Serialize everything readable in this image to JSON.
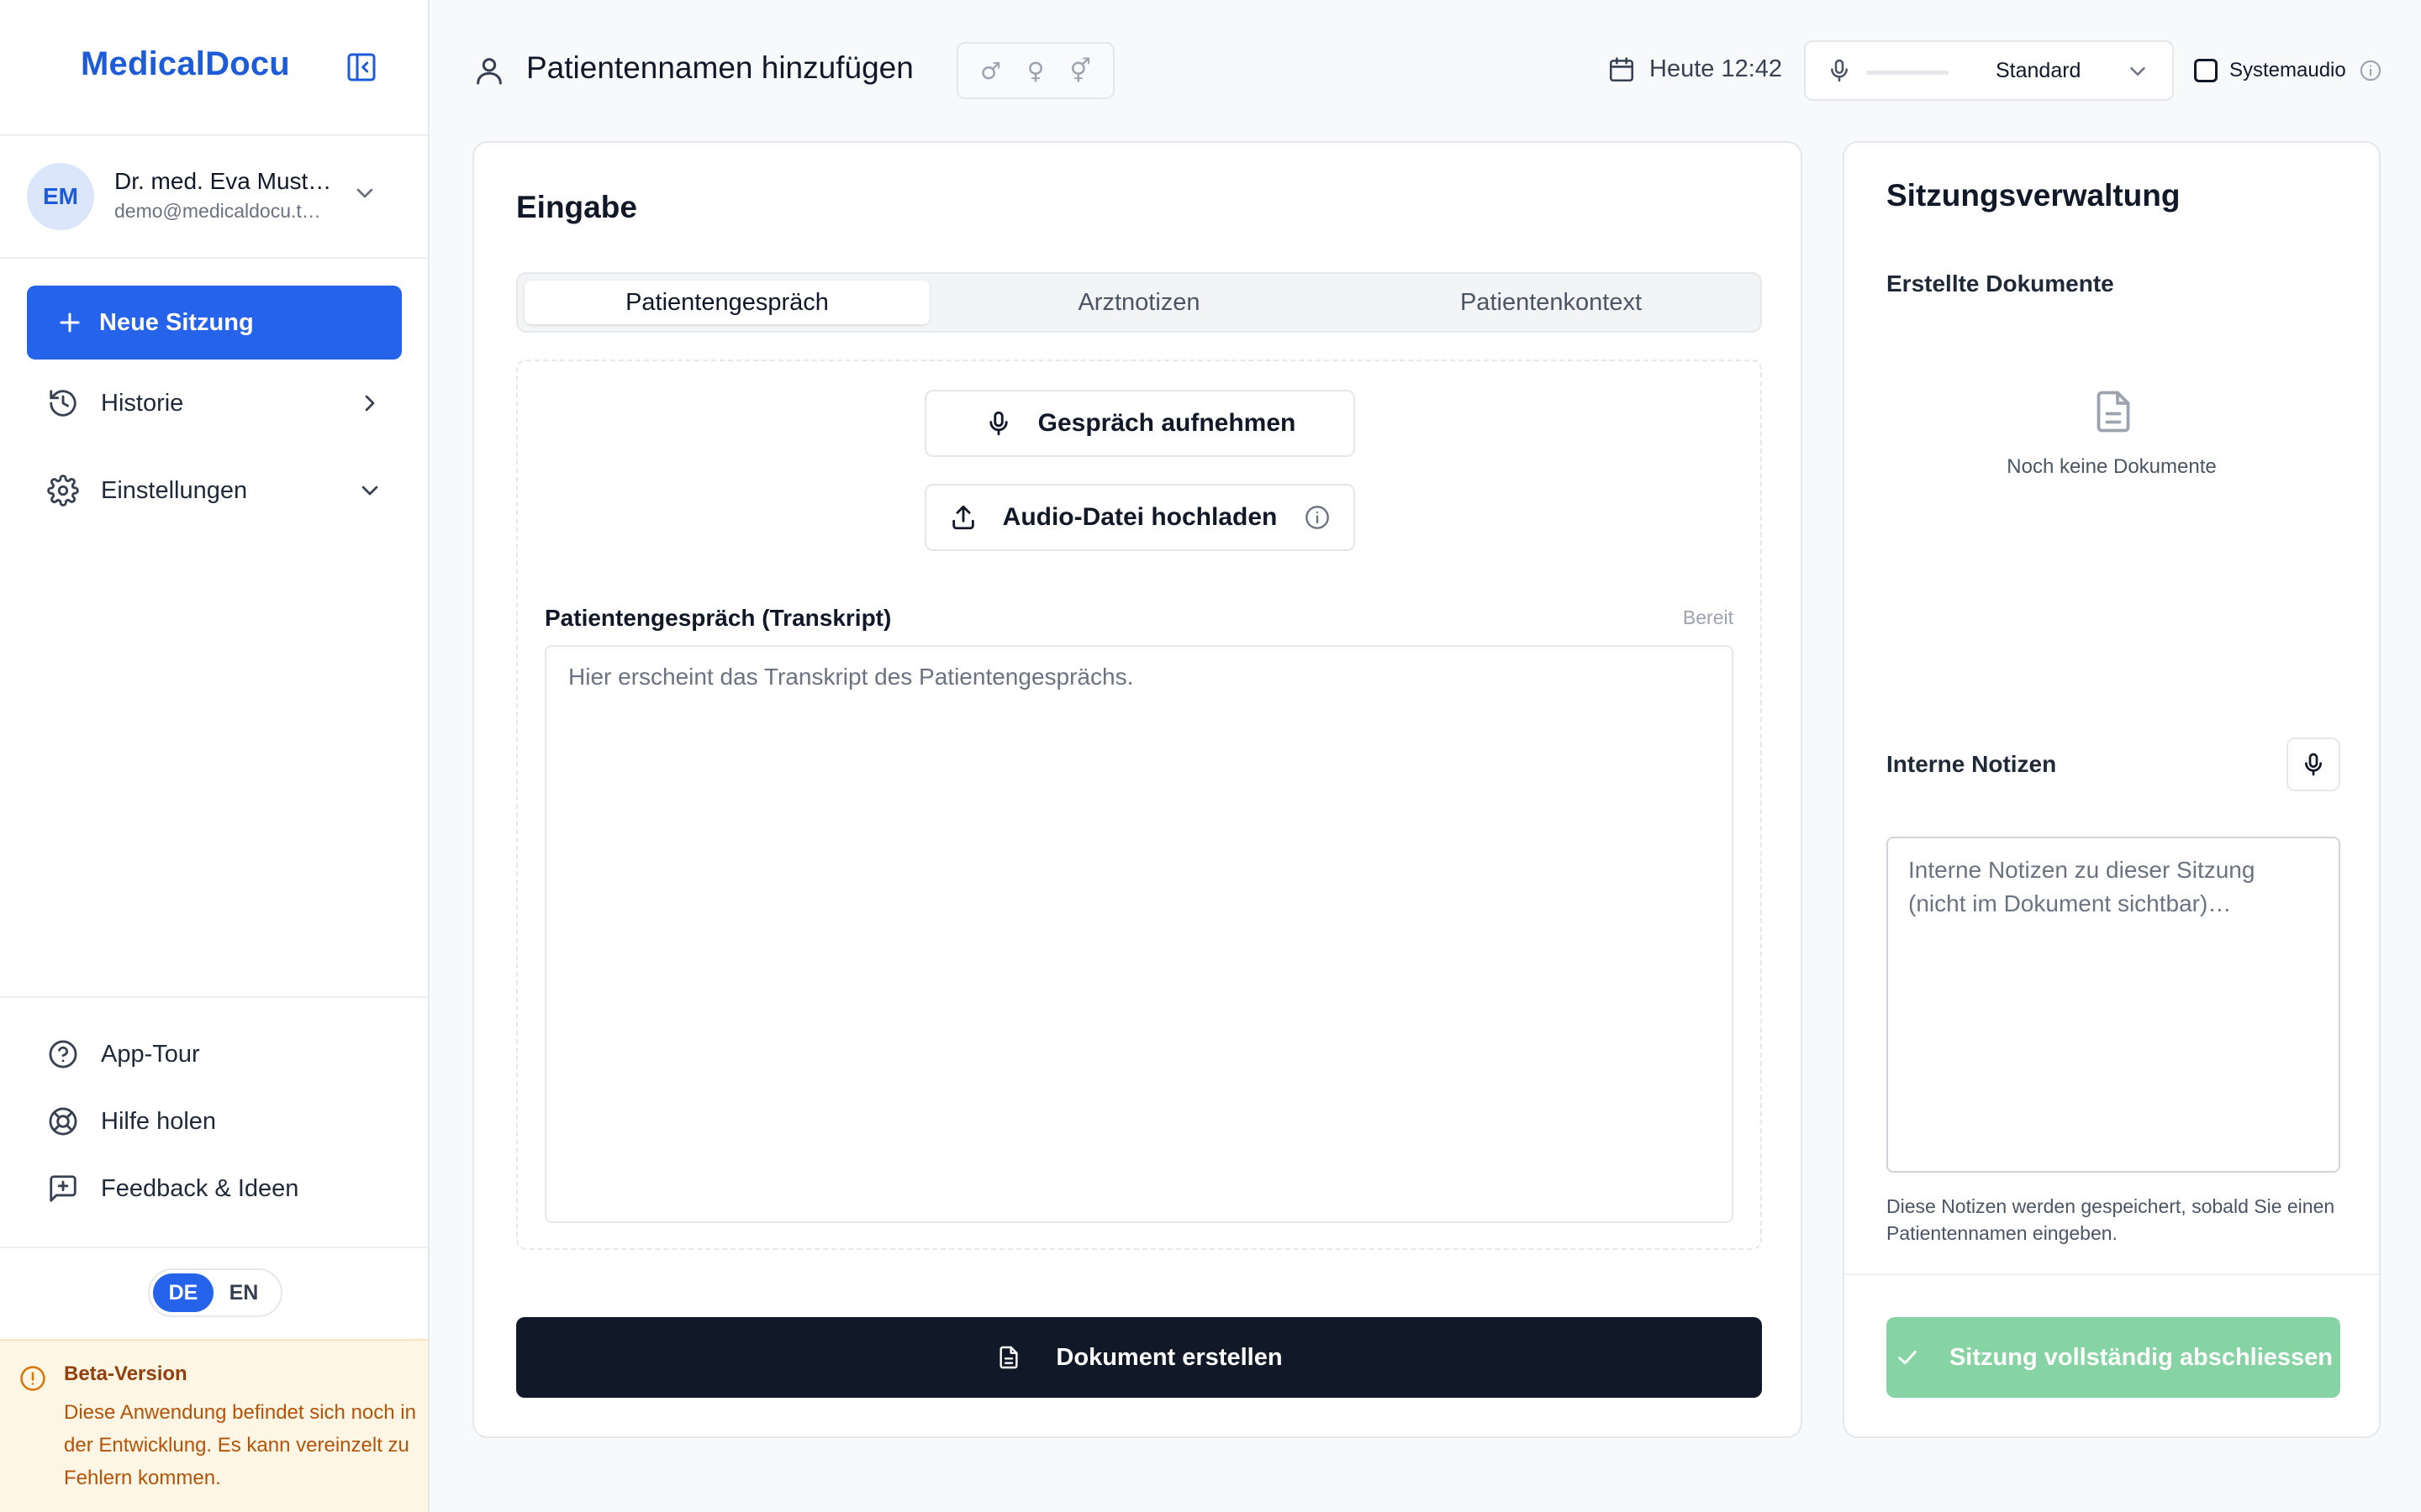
{
  "app": {
    "brand": "MedicalDocu"
  },
  "user": {
    "initials": "EM",
    "name": "Dr. med. Eva Must…",
    "email": "demo@medicaldocu.t…"
  },
  "sidebar": {
    "new_session": "Neue Sitzung",
    "items": [
      {
        "label": "Historie",
        "icon": "history-icon"
      },
      {
        "label": "Einstellungen",
        "icon": "gear-icon"
      }
    ],
    "footer": [
      {
        "label": "App-Tour",
        "icon": "help-circle-icon"
      },
      {
        "label": "Hilfe holen",
        "icon": "lifebuoy-icon"
      },
      {
        "label": "Feedback & Ideen",
        "icon": "feedback-icon"
      }
    ],
    "languages": [
      "DE",
      "EN"
    ],
    "active_language": "DE",
    "beta": {
      "title": "Beta-Version",
      "text": "Diese Anwendung befindet sich noch in der Entwicklung. Es kann vereinzelt zu Fehlern kommen."
    }
  },
  "header": {
    "patient_placeholder": "Patientennamen hinzufügen",
    "genders": [
      "♂",
      "♀",
      "⚥"
    ],
    "date": "Heute 12:42",
    "audio_device": "Standard",
    "audio_level": 0,
    "system_audio_label": "Systemaudio",
    "system_audio_checked": false
  },
  "input": {
    "title": "Eingabe",
    "tabs": [
      "Patientengespräch",
      "Arztnotizen",
      "Patientenkontext"
    ],
    "active_tab": 0,
    "record_button": "Gespräch aufnehmen",
    "upload_button": "Audio-Datei hochladen",
    "transcript_label": "Patientengespräch (Transkript)",
    "transcript_status": "Bereit",
    "transcript_placeholder": "Hier erscheint das Transkript des Patientengesprächs.",
    "transcript_value": "",
    "create_document": "Dokument erstellen"
  },
  "session": {
    "title": "Sitzungsverwaltung",
    "documents_heading": "Erstellte Dokumente",
    "documents_empty": "Noch keine Dokumente",
    "notes_heading": "Interne Notizen",
    "notes_placeholder": "Interne Notizen zu dieser Sitzung (nicht im Dokument sichtbar)…",
    "notes_value": "",
    "notes_hint": "Diese Notizen werden gespeichert, sobald Sie einen Patientennamen eingeben.",
    "complete_button": "Sitzung vollständig abschliessen"
  },
  "colors": {
    "brand": "#1d5bd8",
    "primary": "#2563eb",
    "dark_button": "#111827",
    "success_disabled": "#86d3a3",
    "beta_bg": "#fef6e4",
    "beta_text": "#b45309"
  }
}
